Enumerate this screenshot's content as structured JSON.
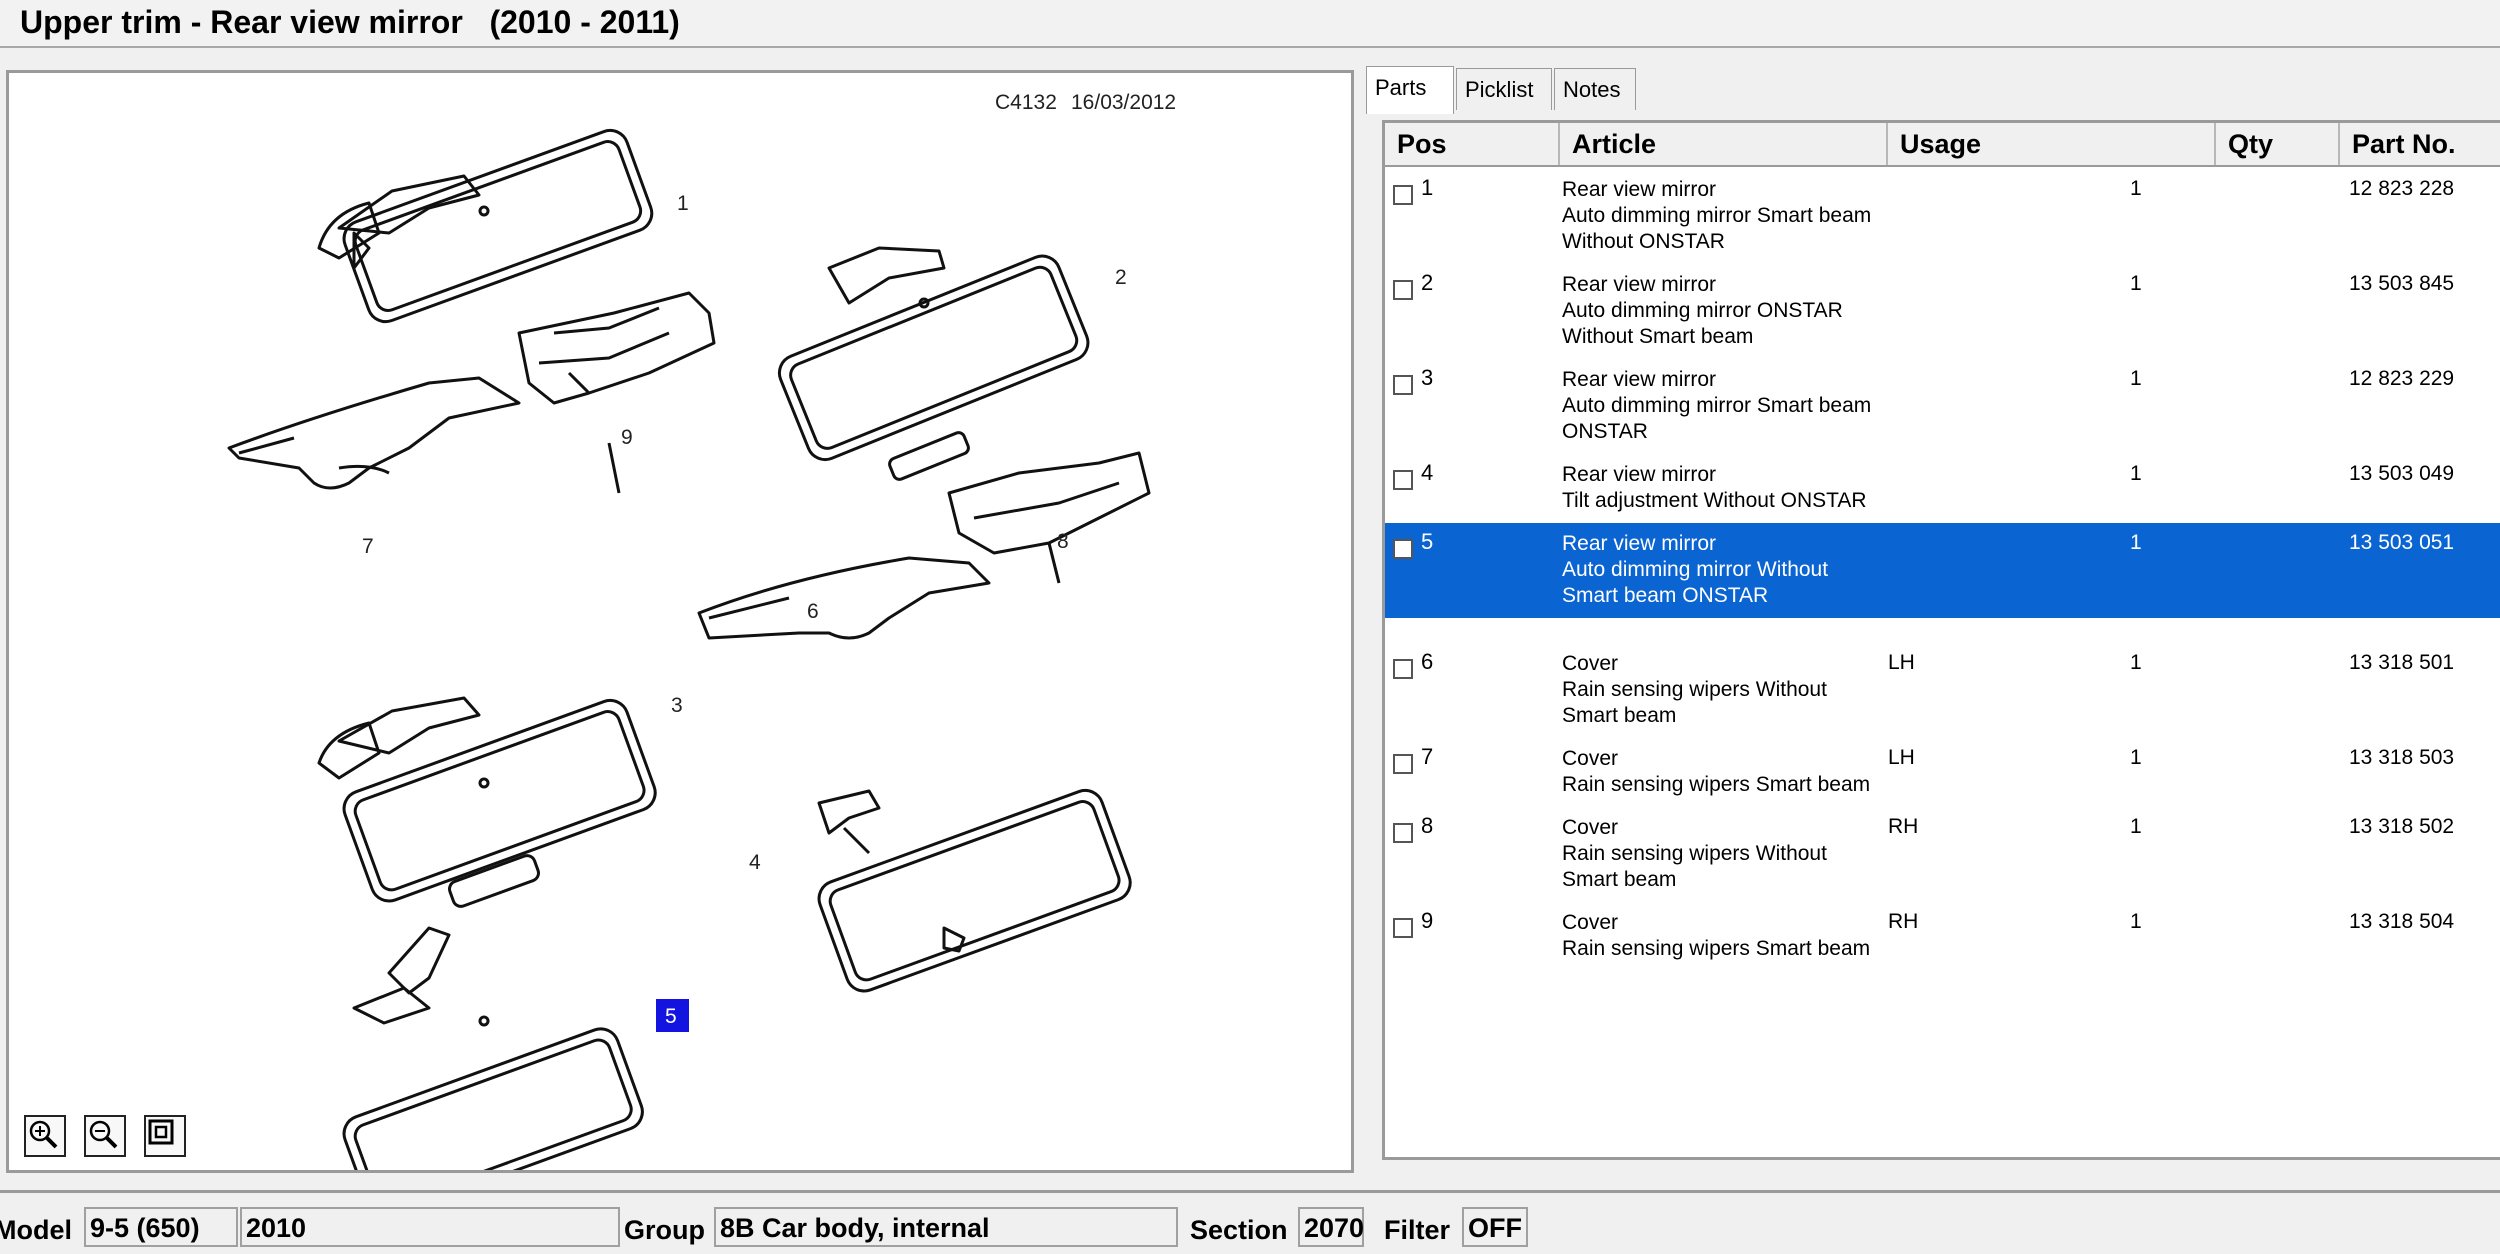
{
  "window": {
    "title": "Upper trim - Rear view mirror   (2010 - 2011)"
  },
  "diagram": {
    "code": "C4132",
    "date": "16/03/2012",
    "callouts": [
      "1",
      "2",
      "3",
      "4",
      "5",
      "6",
      "7",
      "8",
      "9"
    ],
    "highlighted_callout": "5",
    "zoom_in_icon": "magnifier-plus-icon",
    "zoom_out_icon": "magnifier-minus-icon",
    "fit_icon": "fit-window-icon"
  },
  "tabs": [
    {
      "label": "Parts",
      "active": true
    },
    {
      "label": "Picklist",
      "active": false
    },
    {
      "label": "Notes",
      "active": false
    }
  ],
  "table": {
    "headers": {
      "pos": "Pos",
      "article": "Article",
      "usage": "Usage",
      "qty": "Qty",
      "partno": "Part No."
    },
    "rows": [
      {
        "pos": "1",
        "article": [
          "Rear view mirror",
          "Auto dimming mirror  Smart beam",
          "Without  ONSTAR"
        ],
        "usage": "",
        "qty": "1",
        "partno": "12 823 228",
        "selected": false
      },
      {
        "pos": "2",
        "article": [
          "Rear view mirror",
          "Auto dimming mirror  ONSTAR",
          "Without  Smart beam"
        ],
        "usage": "",
        "qty": "1",
        "partno": "13 503 845",
        "selected": false
      },
      {
        "pos": "3",
        "article": [
          "Rear view mirror",
          "Auto dimming mirror  Smart beam",
          "ONSTAR"
        ],
        "usage": "",
        "qty": "1",
        "partno": "12 823 229",
        "selected": false
      },
      {
        "pos": "4",
        "article": [
          "Rear view mirror",
          "Tilt adjustment  Without  ONSTAR"
        ],
        "usage": "",
        "qty": "1",
        "partno": "13 503 049",
        "selected": false
      },
      {
        "pos": "5",
        "article": [
          "Rear view mirror",
          "Auto dimming mirror  Without",
          "Smart beam  ONSTAR"
        ],
        "usage": "",
        "qty": "1",
        "partno": "13 503 051",
        "selected": true
      },
      {
        "pos": "6",
        "article": [
          "Cover",
          "Rain sensing wipers  Without",
          "Smart beam"
        ],
        "usage": "LH",
        "qty": "1",
        "partno": "13 318 501",
        "selected": false
      },
      {
        "pos": "7",
        "article": [
          "Cover",
          "Rain sensing wipers  Smart beam"
        ],
        "usage": "LH",
        "qty": "1",
        "partno": "13 318 503",
        "selected": false
      },
      {
        "pos": "8",
        "article": [
          "Cover",
          "Rain sensing wipers  Without",
          "Smart beam"
        ],
        "usage": "RH",
        "qty": "1",
        "partno": "13 318 502",
        "selected": false
      },
      {
        "pos": "9",
        "article": [
          "Cover",
          "Rain sensing wipers  Smart beam"
        ],
        "usage": "RH",
        "qty": "1",
        "partno": "13 318 504",
        "selected": false
      }
    ]
  },
  "statusbar": {
    "model_label": "Model",
    "model_value": "9-5 (650)",
    "year_value": "2010",
    "group_label": "Group",
    "group_value": "8B Car body, internal",
    "section_label": "Section",
    "section_value": "2070",
    "filter_label": "Filter",
    "filter_value": "OFF"
  },
  "colors": {
    "selection": "#0a64d2",
    "callout_highlight": "#1414e0"
  }
}
